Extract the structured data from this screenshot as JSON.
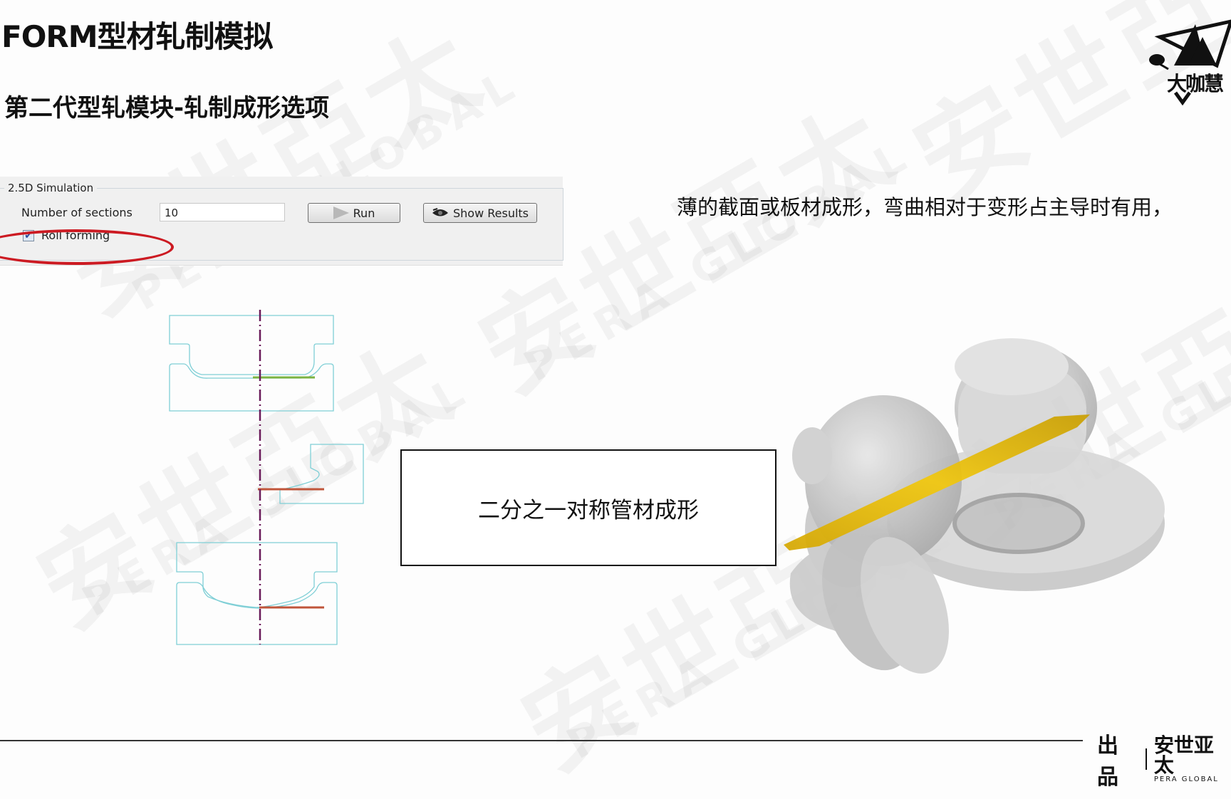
{
  "slide": {
    "title": "FORM型材轧制模拟",
    "subtitle": "第二代型轧模块-轧制成形选项",
    "description": "薄的截面或板材成形，弯曲相对于变形占主导时有用，",
    "box_label": "二分之一对称管材成形"
  },
  "logo": {
    "icon": "triangle-speech-logo-icon",
    "text": "大咖慧"
  },
  "simulation_panel": {
    "group_title": "2.5D Simulation",
    "sections_label": "Number of sections",
    "sections_value": "10",
    "run_label": "Run",
    "run_icon": "play-icon",
    "show_results_label": "Show Results",
    "show_results_icon": "eye-icon",
    "roll_forming_label": "Roll forming",
    "roll_forming_checked": true,
    "highlight_color": "#cc1a22"
  },
  "diagram": {
    "outline_color": "#7fcfd6",
    "centerline_color": "#6a1b5a",
    "strip_colors": [
      "#7cb342",
      "#c0553a",
      "#c0553a"
    ]
  },
  "render": {
    "roll_color": "#c8c8c8",
    "strip_color": "#e2b80a"
  },
  "footer": {
    "made_by": "出品",
    "brand_cn": "安世亚太",
    "brand_en": "PERA GLOBAL"
  },
  "watermark": {
    "cn": "安世亞太",
    "en": "PERA GLOBAL"
  }
}
